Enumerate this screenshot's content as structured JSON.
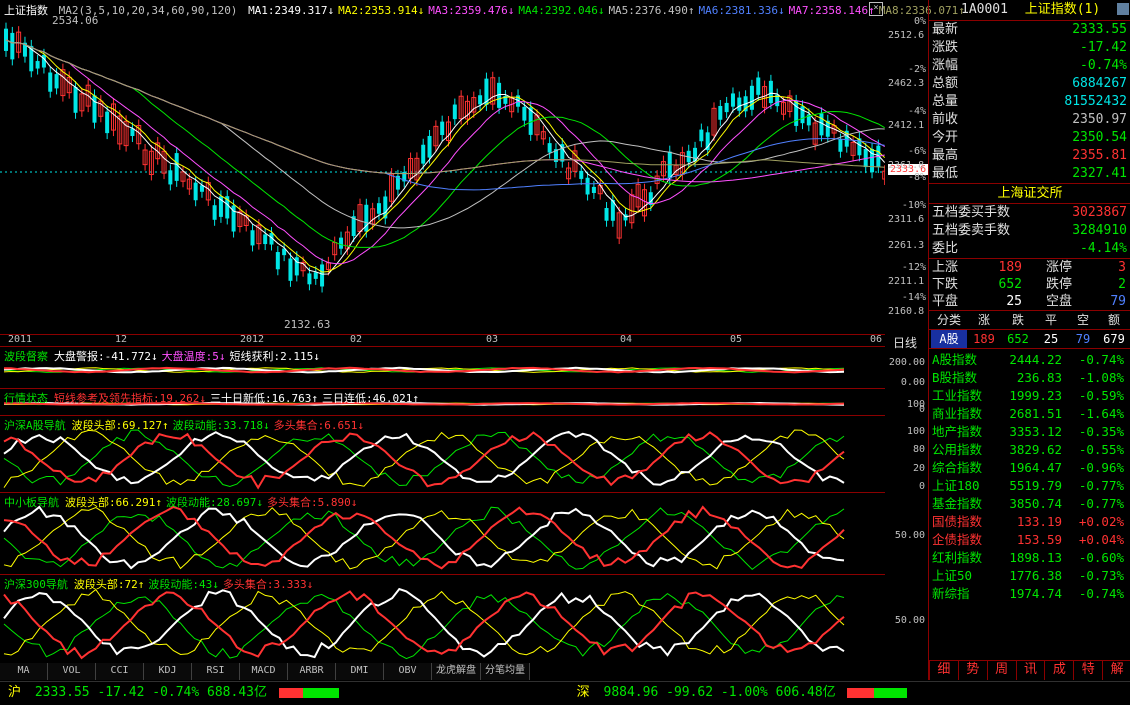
{
  "main": {
    "index_name": "上证指数",
    "ma_params": "MA2(3,5,10,20,34,60,90,120)",
    "mas": [
      {
        "label": "MA1:2349.317↓",
        "color": "#ffffff"
      },
      {
        "label": "MA2:2353.914↓",
        "color": "#ffff00"
      },
      {
        "label": "MA3:2359.476↓",
        "color": "#ff50ff"
      },
      {
        "label": "MA4:2392.046↓",
        "color": "#00e600"
      },
      {
        "label": "MA5:2376.490↑",
        "color": "#c0c0c0"
      },
      {
        "label": "MA6:2381.336↓",
        "color": "#5080ff"
      },
      {
        "label": "MA7:2358.146↑",
        "color": "#ff50ff"
      },
      {
        "label": "MA8:2336.071↑",
        "color": "#a0a060"
      }
    ],
    "high_mark": "2534.06",
    "low_mark": "2132.63",
    "current_price_tag": "2333.6",
    "y_labels": [
      {
        "pct": "0%",
        "price": "2512.6"
      },
      {
        "pct": "-2%",
        "price": "2462.3"
      },
      {
        "pct": "-4%",
        "price": "2412.1"
      },
      {
        "pct": "-6%",
        "price": "2361.8"
      },
      {
        "pct": "-8%",
        "price": ""
      },
      {
        "pct": "-10%",
        "price": "2311.6"
      },
      {
        "pct": "",
        "price": "2261.3"
      },
      {
        "pct": "-12%",
        "price": "2211.1"
      },
      {
        "pct": "-14%",
        "price": "2160.8"
      }
    ],
    "x_labels": [
      "2011",
      "12",
      "2012",
      "02",
      "03",
      "04",
      "05",
      "06"
    ],
    "period": "日线"
  },
  "sub_panels": [
    {
      "title": "波段督察",
      "items": [
        {
          "t": "大盘警报:-41.772↓",
          "c": "#ffffff"
        },
        {
          "t": "大盘温度:5↓",
          "c": "#ff50ff"
        },
        {
          "t": "短线获利:2.115↓",
          "c": "#ffffff"
        }
      ],
      "axis": [
        "200.00",
        "0.00"
      ]
    },
    {
      "title": "行情状态",
      "items": [
        {
          "t": "短线参考及领先指标:19.262↓",
          "c": "#ff3232"
        },
        {
          "t": "三十日新低:16.763↑",
          "c": "#ffffff"
        },
        {
          "t": "三日连低:46.021↑",
          "c": "#ffffff"
        }
      ],
      "axis": [
        "100",
        "0"
      ]
    },
    {
      "title": "沪深A股导航",
      "items": [
        {
          "t": "波段头部:69.127↑",
          "c": "#ffff00"
        },
        {
          "t": "波段动能:33.718↓",
          "c": "#00e600"
        },
        {
          "t": "多头集合:6.651↓",
          "c": "#ff3232"
        }
      ],
      "axis": [
        "100",
        "80",
        "20",
        "0"
      ]
    },
    {
      "title": "中小板导航",
      "items": [
        {
          "t": "波段头部:66.291↑",
          "c": "#ffff00"
        },
        {
          "t": "波段动能:28.697↓",
          "c": "#00e600"
        },
        {
          "t": "多头集合:5.890↓",
          "c": "#ff3232"
        }
      ],
      "axis": [
        "50.00"
      ]
    },
    {
      "title": "沪深300导航",
      "items": [
        {
          "t": "波段头部:72↑",
          "c": "#ffff00"
        },
        {
          "t": "波段动能:43↓",
          "c": "#00e600"
        },
        {
          "t": "多头集合:3.333↓",
          "c": "#ff3232"
        }
      ],
      "axis": [
        "50.00"
      ]
    }
  ],
  "tabs": [
    "MA",
    "VOL",
    "CCI",
    "KDJ",
    "RSI",
    "MACD",
    "ARBR",
    "DMI",
    "OBV",
    "龙虎解盘",
    "分笔均量"
  ],
  "quote": {
    "code": "1A0001",
    "name": "上证指数(1)",
    "rows": [
      {
        "label": "最新",
        "value": "2333.55",
        "color": "#00e600"
      },
      {
        "label": "涨跌",
        "value": "-17.42",
        "color": "#00e600"
      },
      {
        "label": "涨幅",
        "value": "-0.74%",
        "color": "#00e600"
      },
      {
        "label": "总额",
        "value": "6884267",
        "color": "#00e6e6"
      },
      {
        "label": "总量",
        "value": "81552432",
        "color": "#00e6e6"
      },
      {
        "label": "前收",
        "value": "2350.97",
        "color": "#c0c0c0"
      },
      {
        "label": "今开",
        "value": "2350.54",
        "color": "#00e600"
      },
      {
        "label": "最高",
        "value": "2355.81",
        "color": "#ff3232"
      },
      {
        "label": "最低",
        "value": "2327.41",
        "color": "#00e600"
      }
    ],
    "exchange": "上海证交所",
    "order_rows": [
      {
        "label": "五档委买手数",
        "value": "3023867",
        "color": "#ff3232"
      },
      {
        "label": "五档委卖手数",
        "value": "3284910",
        "color": "#00e600"
      },
      {
        "label": "委比",
        "value": "-4.14%",
        "color": "#00e600"
      }
    ],
    "breadth": [
      {
        "l1": "上涨",
        "v1": "189",
        "c1": "#ff3232",
        "l2": "涨停",
        "v2": "3",
        "c2": "#ff3232"
      },
      {
        "l1": "下跌",
        "v1": "652",
        "c1": "#00e600",
        "l2": "跌停",
        "v2": "2",
        "c2": "#00e600"
      },
      {
        "l1": "平盘",
        "v1": "25",
        "c1": "#ffffff",
        "l2": "空盘",
        "v2": "79",
        "c2": "#5080ff"
      }
    ],
    "class_header": [
      "分类",
      "涨",
      "跌",
      "平",
      "空",
      "额"
    ],
    "class_row": {
      "name": "A股",
      "up": "189",
      "down": "652",
      "flat": "25",
      "empty": "79",
      "amt": "679"
    },
    "indices": [
      {
        "n": "A股指数",
        "v": "2444.22",
        "p": "-0.74%",
        "c": "#00e600"
      },
      {
        "n": "B股指数",
        "v": "236.83",
        "p": "-1.08%",
        "c": "#00e600"
      },
      {
        "n": "工业指数",
        "v": "1999.23",
        "p": "-0.59%",
        "c": "#00e600"
      },
      {
        "n": "商业指数",
        "v": "2681.51",
        "p": "-1.64%",
        "c": "#00e600"
      },
      {
        "n": "地产指数",
        "v": "3353.12",
        "p": "-0.35%",
        "c": "#00e600"
      },
      {
        "n": "公用指数",
        "v": "3829.62",
        "p": "-0.55%",
        "c": "#00e600"
      },
      {
        "n": "综合指数",
        "v": "1964.47",
        "p": "-0.96%",
        "c": "#00e600"
      },
      {
        "n": "上证180",
        "v": "5519.79",
        "p": "-0.77%",
        "c": "#00e600"
      },
      {
        "n": "基金指数",
        "v": "3850.74",
        "p": "-0.77%",
        "c": "#00e600"
      },
      {
        "n": "国债指数",
        "v": "133.19",
        "p": "+0.02%",
        "c": "#ff3232"
      },
      {
        "n": "企债指数",
        "v": "153.59",
        "p": "+0.04%",
        "c": "#ff3232"
      },
      {
        "n": "红利指数",
        "v": "1898.13",
        "p": "-0.60%",
        "c": "#00e600"
      },
      {
        "n": "上证50",
        "v": "1776.38",
        "p": "-0.73%",
        "c": "#00e600"
      },
      {
        "n": "新综指",
        "v": "1974.74",
        "p": "-0.74%",
        "c": "#00e600"
      }
    ],
    "side_tabs": [
      "细",
      "势",
      "周",
      "讯",
      "成",
      "特",
      "解"
    ]
  },
  "status": {
    "sh_label": "沪",
    "sh_text": "2333.55 -17.42 -0.74% 688.43亿",
    "sz_label": "深",
    "sz_text": "9884.96 -99.62 -1.00% 606.48亿"
  }
}
